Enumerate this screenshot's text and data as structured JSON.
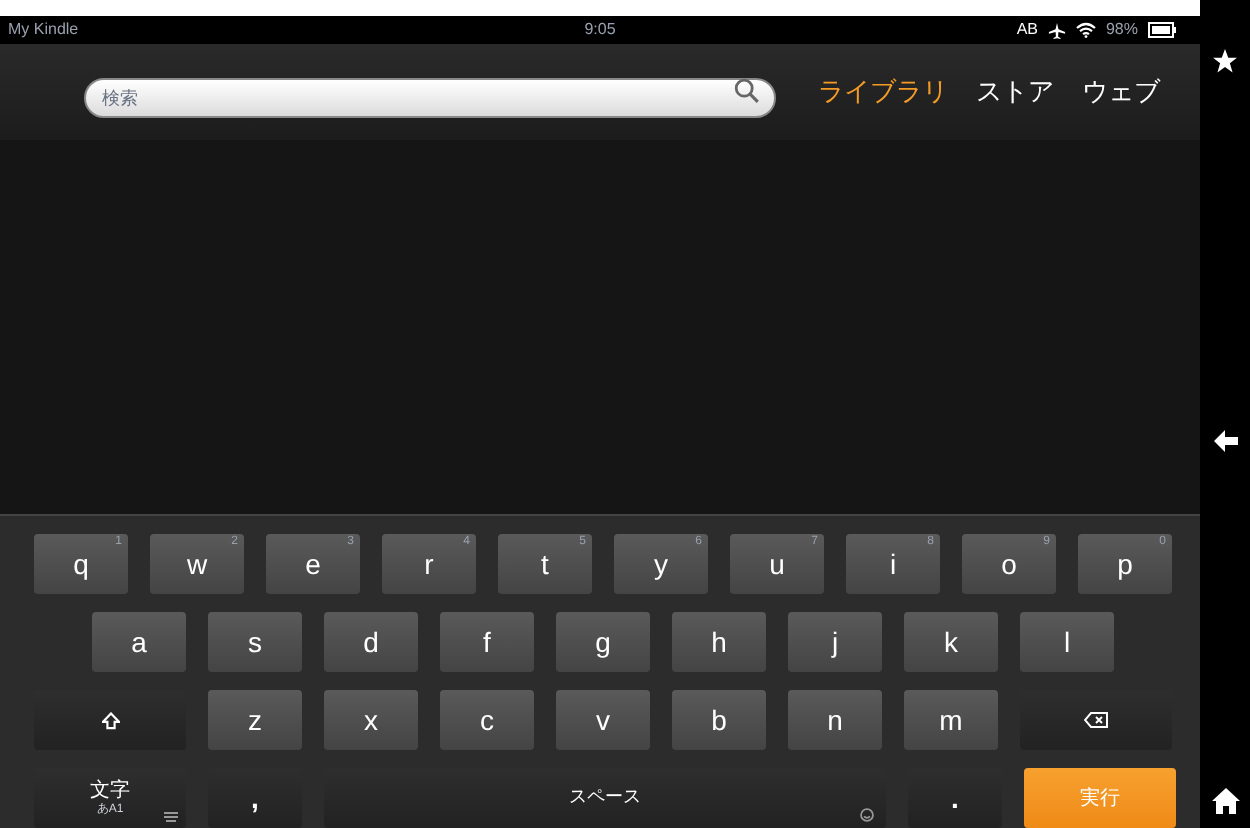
{
  "status_bar": {
    "title": "My Kindle",
    "time": "9:05",
    "network": "AB",
    "battery": "98%"
  },
  "search": {
    "placeholder": "検索"
  },
  "tabs": [
    {
      "label": "ライブラリ",
      "selected": true
    },
    {
      "label": "ストア",
      "selected": false
    },
    {
      "label": "ウェブ",
      "selected": false
    }
  ],
  "keyboard": {
    "rows": [
      {
        "keys": [
          {
            "kind": "char",
            "label": "q",
            "hint": "1"
          },
          {
            "kind": "char",
            "label": "w",
            "hint": "2"
          },
          {
            "kind": "char",
            "label": "e",
            "hint": "3"
          },
          {
            "kind": "char",
            "label": "r",
            "hint": "4"
          },
          {
            "kind": "char",
            "label": "t",
            "hint": "5"
          },
          {
            "kind": "char",
            "label": "y",
            "hint": "6"
          },
          {
            "kind": "char",
            "label": "u",
            "hint": "7"
          },
          {
            "kind": "char",
            "label": "i",
            "hint": "8"
          },
          {
            "kind": "char",
            "label": "o",
            "hint": "9"
          },
          {
            "kind": "char",
            "label": "p",
            "hint": "0"
          }
        ]
      },
      {
        "keys": [
          {
            "kind": "char",
            "label": "a"
          },
          {
            "kind": "char",
            "label": "s"
          },
          {
            "kind": "char",
            "label": "d"
          },
          {
            "kind": "char",
            "label": "f"
          },
          {
            "kind": "char",
            "label": "g"
          },
          {
            "kind": "char",
            "label": "h"
          },
          {
            "kind": "char",
            "label": "j"
          },
          {
            "kind": "char",
            "label": "k"
          },
          {
            "kind": "char",
            "label": "l"
          }
        ]
      },
      {
        "keys": [
          {
            "kind": "shift"
          },
          {
            "kind": "char",
            "label": "z"
          },
          {
            "kind": "char",
            "label": "x"
          },
          {
            "kind": "char",
            "label": "c"
          },
          {
            "kind": "char",
            "label": "v"
          },
          {
            "kind": "char",
            "label": "b"
          },
          {
            "kind": "char",
            "label": "n"
          },
          {
            "kind": "char",
            "label": "m"
          },
          {
            "kind": "backspace"
          }
        ]
      },
      {
        "keys": [
          {
            "kind": "mode",
            "label": "文字",
            "hint": "あA1"
          },
          {
            "kind": "dark",
            "label": ","
          },
          {
            "kind": "space",
            "label": "スペース"
          },
          {
            "kind": "dark",
            "label": "."
          },
          {
            "kind": "enter",
            "label": "実行"
          }
        ]
      }
    ]
  }
}
